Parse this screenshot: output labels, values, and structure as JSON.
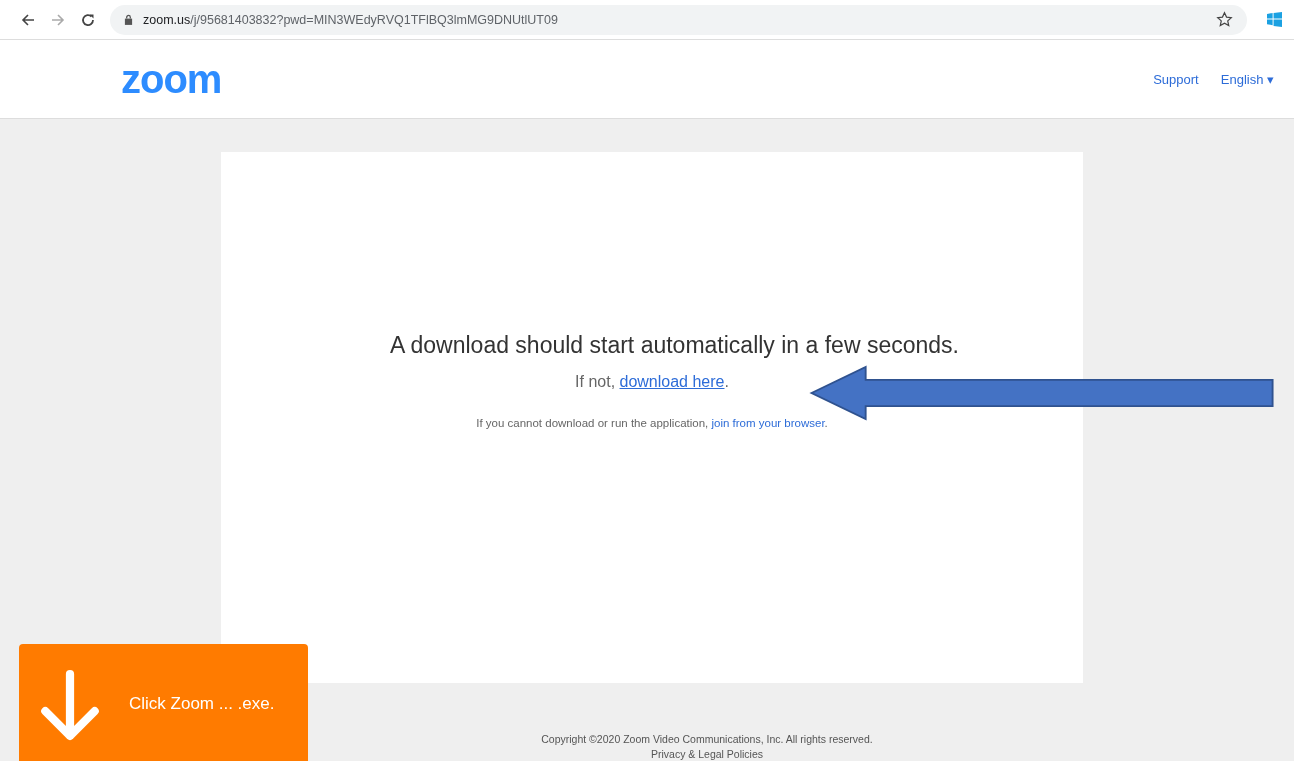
{
  "browser": {
    "url_host": "zoom.us",
    "url_path": "/j/95681403832?pwd=MIN3WEdyRVQ1TFlBQ3lmMG9DNUtlUT09",
    "bookmarked": false
  },
  "header": {
    "logo": "zoom",
    "links": [
      {
        "label": "Support"
      },
      {
        "label": "English ▾"
      }
    ]
  },
  "card": {
    "heading": "A download should start automatically in a few seconds.",
    "fallback_prefix": "If not, ",
    "fallback_link": "download here",
    "fallback_suffix": ".",
    "browser_prefix": "If you cannot download or run the application, ",
    "browser_link": "join from your browser",
    "browser_suffix": "."
  },
  "footer": {
    "copyright": "Copyright ©2020 Zoom Video Communications, Inc. All rights reserved.",
    "policies": "Privacy & Legal Policies"
  },
  "download_prompt": {
    "text": "Click Zoom ... .exe."
  }
}
